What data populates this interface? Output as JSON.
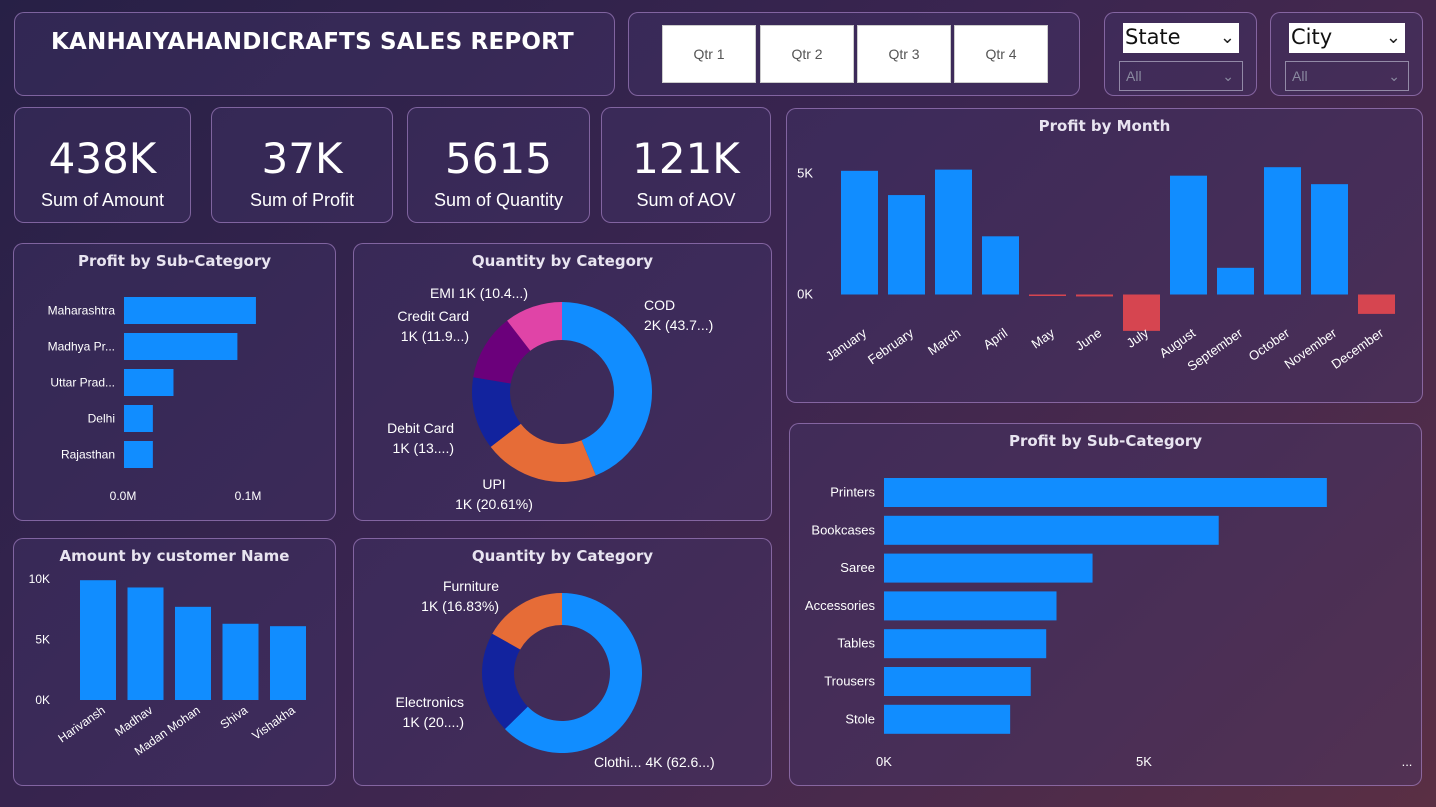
{
  "header": {
    "title": "KANHAIYAHANDICRAFTS SALES REPORT"
  },
  "quarters": [
    "Qtr 1",
    "Qtr 2",
    "Qtr 3",
    "Qtr 4"
  ],
  "slicers": {
    "state": {
      "label": "State",
      "value": "All"
    },
    "city": {
      "label": "City",
      "value": "All"
    }
  },
  "kpis": [
    {
      "value": "438K",
      "label": "Sum of Amount"
    },
    {
      "value": "37K",
      "label": "Sum of Profit"
    },
    {
      "value": "5615",
      "label": "Sum of Quantity"
    },
    {
      "value": "121K",
      "label": "Sum of AOV"
    }
  ],
  "colors": {
    "bar": "#118DFF",
    "negative": "#D64550",
    "cod": "#118DFF",
    "upi": "#E66C37",
    "debit": "#12239E",
    "credit": "#6B007B",
    "emi": "#E044A7"
  },
  "chart_data": [
    {
      "id": "profit-by-state",
      "type": "bar",
      "orientation": "horizontal",
      "title": "Profit by Sub-Category",
      "categories": [
        "Maharashtra",
        "Madhya Pr...",
        "Uttar Prad...",
        "Delhi",
        "Rajasthan"
      ],
      "values": [
        0.128,
        0.11,
        0.048,
        0.028,
        0.028
      ],
      "xticks": [
        "0.0M",
        "0.1M"
      ],
      "xlim": [
        0,
        0.13
      ]
    },
    {
      "id": "quantity-by-payment",
      "type": "pie",
      "title": "Quantity by Category",
      "slices": [
        {
          "label": "COD",
          "value": 43.7,
          "text": "2K (43.7...)"
        },
        {
          "label": "UPI",
          "value": 20.61,
          "text": "1K (20.61%)"
        },
        {
          "label": "Debit Card",
          "value": 13.0,
          "text": "1K (13....)"
        },
        {
          "label": "Credit Card",
          "value": 11.9,
          "text": "1K (11.9...)"
        },
        {
          "label": "EMI",
          "value": 10.4,
          "text": "1K (10.4...)"
        }
      ]
    },
    {
      "id": "amount-by-customer",
      "type": "bar",
      "title": "Amount by customer Name",
      "categories": [
        "Harivansh",
        "Madhav",
        "Madan Mohan",
        "Shiva",
        "Vishakha"
      ],
      "values": [
        9900,
        9300,
        7700,
        6300,
        6100
      ],
      "yticks": [
        "0K",
        "5K",
        "10K"
      ],
      "ylim": [
        0,
        10000
      ]
    },
    {
      "id": "quantity-by-category",
      "type": "pie",
      "title": "Quantity by Category",
      "slices": [
        {
          "label": "Clothi...",
          "value": 62.6,
          "text": "4K (62.6...)"
        },
        {
          "label": "Electronics",
          "value": 20.5,
          "text": "1K (20....)"
        },
        {
          "label": "Furniture",
          "value": 16.83,
          "text": "1K (16.83%)"
        }
      ]
    },
    {
      "id": "profit-by-month",
      "type": "bar",
      "title": "Profit by Month",
      "categories": [
        "January",
        "February",
        "March",
        "April",
        "May",
        "June",
        "July",
        "August",
        "September",
        "October",
        "November",
        "December"
      ],
      "values": [
        5100,
        4100,
        5150,
        2400,
        -60,
        -80,
        -1500,
        4900,
        1100,
        5250,
        4550,
        -800
      ],
      "yticks": [
        "0K",
        "5K"
      ],
      "ylim": [
        -2000,
        6000
      ]
    },
    {
      "id": "profit-by-subcategory",
      "type": "bar",
      "orientation": "horizontal",
      "title": "Profit by Sub-Category",
      "categories": [
        "Printers",
        "Bookcases",
        "Saree",
        "Accessories",
        "Tables",
        "Trousers",
        "Stole"
      ],
      "values": [
        8600,
        6500,
        4050,
        3350,
        3150,
        2850,
        2450
      ],
      "xticks": [
        "0K",
        "5K",
        "..."
      ],
      "xlim": [
        0,
        8700
      ]
    }
  ]
}
